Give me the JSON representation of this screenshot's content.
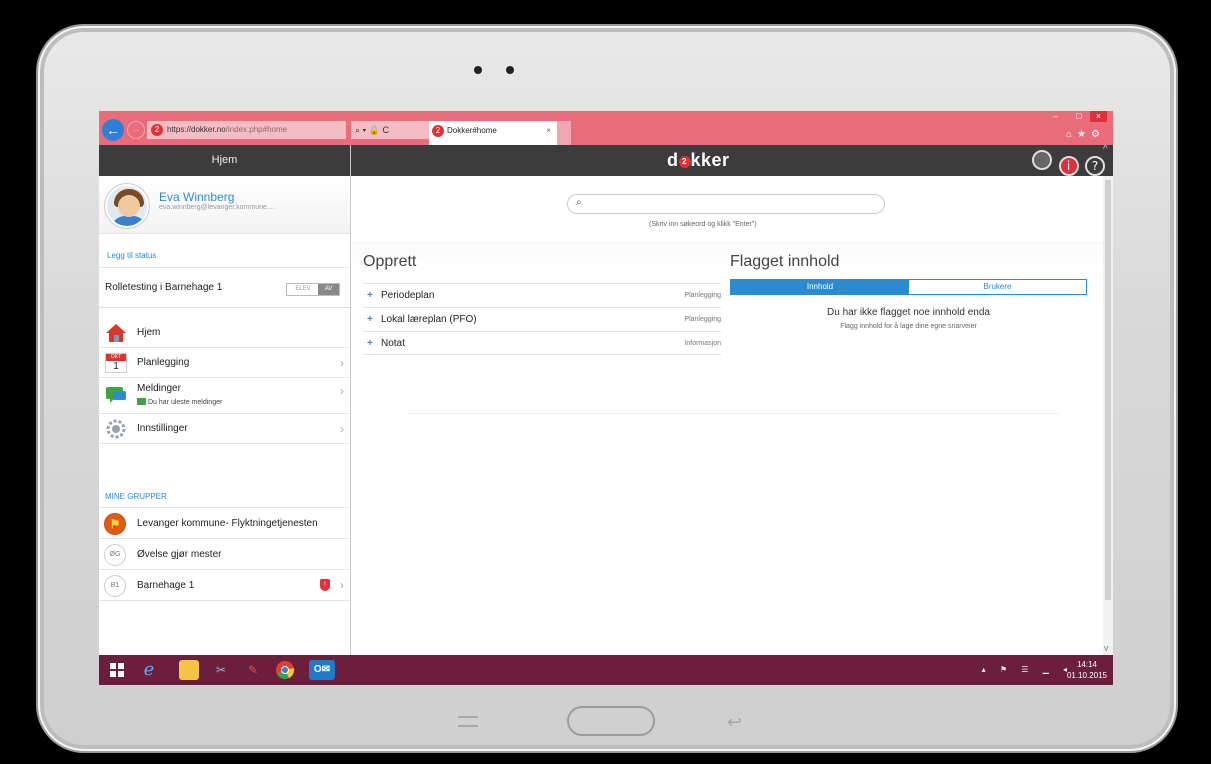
{
  "browser": {
    "url_host": "https://dokker.no",
    "url_path": "/index.php#home",
    "tools": "⌕ ▾ 🔒 C",
    "tab_title": "Dokker#home",
    "tab_close": "×",
    "window_controls": "– □",
    "window_close": "×",
    "top_icons": "⌂★⚙"
  },
  "sidebar": {
    "header": "Hjem",
    "user_name": "Eva Winnberg",
    "user_email": "eva.winnberg@levanger.kommune....",
    "status_link": "Legg til status",
    "role_label": "Rolletesting i Barnehage 1",
    "toggle_off": "ELEV",
    "toggle_on": "AV",
    "nav": [
      {
        "label": "Hjem",
        "icon": "home-icon"
      },
      {
        "label": "Planlegging",
        "icon": "calendar-icon",
        "cal_month": "OKT",
        "cal_day": "1"
      },
      {
        "label": "Meldinger",
        "icon": "messages-icon",
        "sub": "Du har uleste meldinger"
      },
      {
        "label": "Innstillinger",
        "icon": "gear-icon"
      }
    ],
    "groups_heading": "MINE GRUPPER",
    "groups": [
      {
        "label": "Levanger kommune- Flyktningetjenesten",
        "initials": "⚑"
      },
      {
        "label": "Øvelse gjør mester",
        "initials": "ØG"
      },
      {
        "label": "Barnehage 1",
        "initials": "B1",
        "badge": "!"
      }
    ],
    "chevron": "›"
  },
  "header": {
    "logo_left": "d",
    "logo_o": "2",
    "logo_right": "kker",
    "icon_info": "i",
    "icon_help": "?"
  },
  "search": {
    "placeholder": "",
    "icon": "⌕",
    "hint": "(Skriv inn søkeord og klikk \"Enter\")"
  },
  "opprett": {
    "title": "Opprett",
    "items": [
      {
        "label": "Periodeplan",
        "category": "Planlegging"
      },
      {
        "label": "Lokal læreplan (PFO)",
        "category": "Planlegging"
      },
      {
        "label": "Notat",
        "category": "Informasjon"
      }
    ]
  },
  "flagged": {
    "title": "Flagget innhold",
    "tab_content": "Innhold",
    "tab_users": "Brukere",
    "empty_title": "Du har ikke flagget noe innhold enda",
    "empty_sub": "Flagg innhold for å lage dine egne snarveier"
  },
  "taskbar": {
    "clock_time": "14:14",
    "clock_date": "01.10.2015",
    "tray": "▴ ⚑ ☰ ▁ ◂"
  },
  "colors": {
    "accent": "#2a8bd0",
    "browser_bar": "#e96c7b",
    "header_bar": "#3c3c3c",
    "taskbar": "#6b1f3d"
  }
}
